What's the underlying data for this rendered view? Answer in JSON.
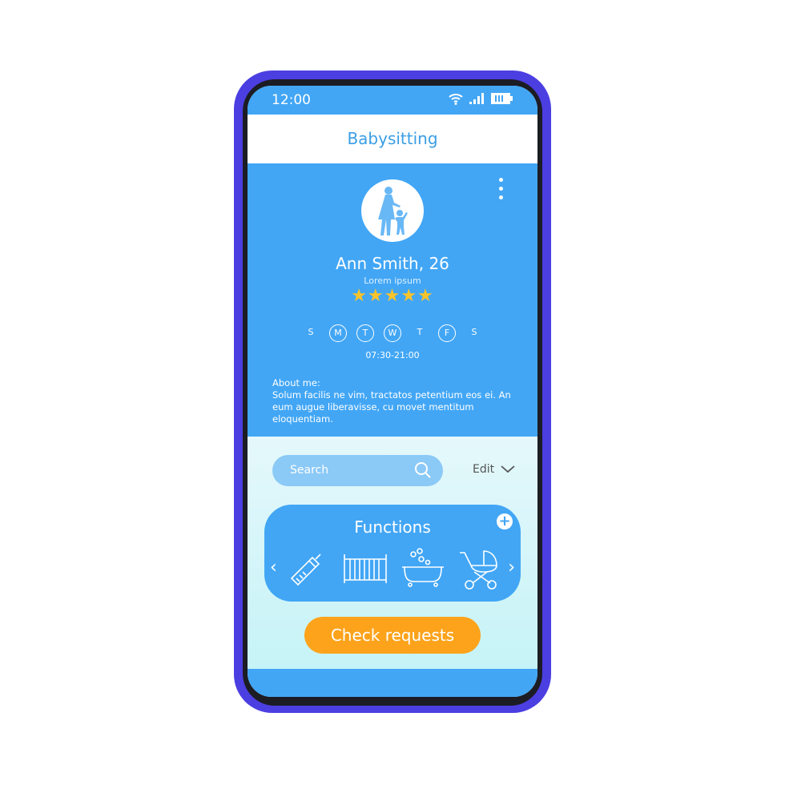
{
  "status": {
    "time": "12:00",
    "icons": [
      "wifi-icon",
      "signal-icon",
      "battery-icon"
    ]
  },
  "header": {
    "title": "Babysitting"
  },
  "profile": {
    "name": "Ann Smith, 26",
    "subtitle": "Lorem ipsum",
    "rating": 5,
    "rating_max": 5,
    "stars": "★★★★★",
    "days": [
      {
        "label": "S",
        "active": false
      },
      {
        "label": "M",
        "active": true
      },
      {
        "label": "T",
        "active": true
      },
      {
        "label": "W",
        "active": true
      },
      {
        "label": "T",
        "active": false
      },
      {
        "label": "F",
        "active": true
      },
      {
        "label": "S",
        "active": false
      }
    ],
    "hours": "07:30-21:00",
    "about_label": "About me:",
    "about_text": "Solum facilis ne vim, tractatos petentium eos ei. An eum augue liberavisse, cu movet mentitum eloquentiam."
  },
  "search": {
    "placeholder": "Search"
  },
  "edit": {
    "label": "Edit"
  },
  "functions": {
    "title": "Functions",
    "items": [
      "baby-bottle-icon",
      "crib-icon",
      "bathtub-icon",
      "stroller-icon"
    ]
  },
  "actions": {
    "check_requests": "Check requests"
  },
  "colors": {
    "frame": "#4b3fe2",
    "primary": "#42a6f5",
    "accent": "#fca31b",
    "star": "#f8c32b"
  }
}
